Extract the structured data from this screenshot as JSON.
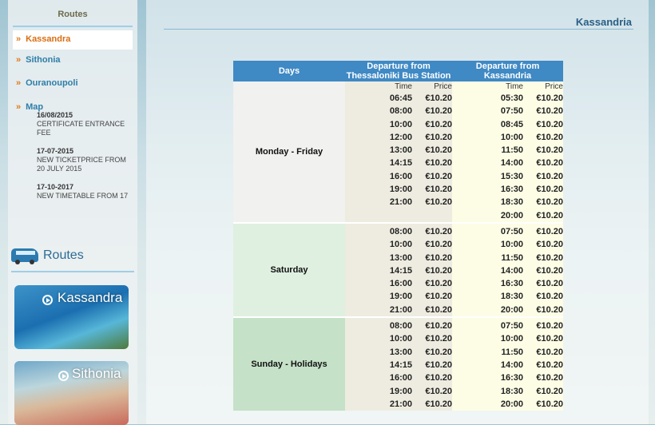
{
  "sidebar": {
    "title": "Routes",
    "nav": [
      {
        "label": "Kassandra",
        "active": true
      },
      {
        "label": "Sithonia",
        "active": false
      },
      {
        "label": "Ouranoupoli",
        "active": false
      },
      {
        "label": "Map",
        "active": false
      }
    ],
    "nav_marker": "»",
    "news": [
      {
        "date": "16/08/2015",
        "text": "CERTIFICATE ENTRANCE FEE"
      },
      {
        "date": "17-07-2015",
        "text": "NEW TICKETPRICE FROM 20 JULY 2015"
      },
      {
        "date": "17-10-2017",
        "text": "NEW TIMETABLE FROM 17"
      }
    ],
    "routes_heading": "Routes",
    "route_cards": [
      {
        "label": "Kassandra"
      },
      {
        "label": "Sithonia"
      }
    ]
  },
  "main": {
    "title": "Kassandria",
    "table": {
      "headers": {
        "days": "Days",
        "from_thessaloniki": "Departure from Thessaloniki Bus Station",
        "from_kassandria": "Departure from Kassandria"
      },
      "subheaders": {
        "time": "Time",
        "price": "Price"
      },
      "groups": [
        {
          "days": "Monday - Friday",
          "thessaloniki": [
            {
              "time": "06:45",
              "price": "€10.20"
            },
            {
              "time": "08:00",
              "price": "€10.20"
            },
            {
              "time": "10:00",
              "price": "€10.20"
            },
            {
              "time": "12:00",
              "price": "€10.20"
            },
            {
              "time": "13:00",
              "price": "€10.20"
            },
            {
              "time": "14:15",
              "price": "€10.20"
            },
            {
              "time": "16:00",
              "price": "€10.20"
            },
            {
              "time": "19:00",
              "price": "€10.20"
            },
            {
              "time": "21:00",
              "price": "€10.20"
            }
          ],
          "kassandria": [
            {
              "time": "05:30",
              "price": "€10.20"
            },
            {
              "time": "07:50",
              "price": "€10.20"
            },
            {
              "time": "08:45",
              "price": "€10.20"
            },
            {
              "time": "10:00",
              "price": "€10.20"
            },
            {
              "time": "11:50",
              "price": "€10.20"
            },
            {
              "time": "14:00",
              "price": "€10.20"
            },
            {
              "time": "15:30",
              "price": "€10.20"
            },
            {
              "time": "16:30",
              "price": "€10.20"
            },
            {
              "time": "18:30",
              "price": "€10.20"
            },
            {
              "time": "20:00",
              "price": "€10.20"
            }
          ]
        },
        {
          "days": "Saturday",
          "thessaloniki": [
            {
              "time": "08:00",
              "price": "€10.20"
            },
            {
              "time": "10:00",
              "price": "€10.20"
            },
            {
              "time": "13:00",
              "price": "€10.20"
            },
            {
              "time": "14:15",
              "price": "€10.20"
            },
            {
              "time": "16:00",
              "price": "€10.20"
            },
            {
              "time": "19:00",
              "price": "€10.20"
            },
            {
              "time": "21:00",
              "price": "€10.20"
            }
          ],
          "kassandria": [
            {
              "time": "07:50",
              "price": "€10.20"
            },
            {
              "time": "10:00",
              "price": "€10.20"
            },
            {
              "time": "11:50",
              "price": "€10.20"
            },
            {
              "time": "14:00",
              "price": "€10.20"
            },
            {
              "time": "16:30",
              "price": "€10.20"
            },
            {
              "time": "18:30",
              "price": "€10.20"
            },
            {
              "time": "20:00",
              "price": "€10.20"
            }
          ]
        },
        {
          "days": "Sunday - Holidays",
          "thessaloniki": [
            {
              "time": "08:00",
              "price": "€10.20"
            },
            {
              "time": "10:00",
              "price": "€10.20"
            },
            {
              "time": "13:00",
              "price": "€10.20"
            },
            {
              "time": "14:15",
              "price": "€10.20"
            },
            {
              "time": "16:00",
              "price": "€10.20"
            },
            {
              "time": "19:00",
              "price": "€10.20"
            },
            {
              "time": "21:00",
              "price": "€10.20"
            }
          ],
          "kassandria": [
            {
              "time": "07:50",
              "price": "€10.20"
            },
            {
              "time": "10:00",
              "price": "€10.20"
            },
            {
              "time": "11:50",
              "price": "€10.20"
            },
            {
              "time": "14:00",
              "price": "€10.20"
            },
            {
              "time": "16:30",
              "price": "€10.20"
            },
            {
              "time": "18:30",
              "price": "€10.20"
            },
            {
              "time": "20:00",
              "price": "€10.20"
            }
          ]
        }
      ]
    }
  }
}
